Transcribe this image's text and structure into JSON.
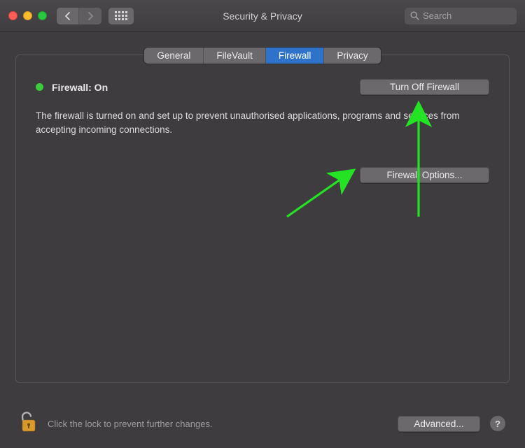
{
  "window": {
    "title": "Security & Privacy",
    "search_placeholder": "Search"
  },
  "tabs": [
    {
      "label": "General"
    },
    {
      "label": "FileVault"
    },
    {
      "label": "Firewall",
      "active": true
    },
    {
      "label": "Privacy"
    }
  ],
  "firewall": {
    "status_label": "Firewall: On",
    "status_color": "#3ccb3c",
    "turn_off_label": "Turn Off Firewall",
    "description": "The firewall is turned on and set up to prevent unauthorised applications, programs and services from accepting incoming connections.",
    "options_label": "Firewall Options..."
  },
  "footer": {
    "lock_text": "Click the lock to prevent further changes.",
    "advanced_label": "Advanced...",
    "help_label": "?"
  },
  "annotations": {
    "arrow_color": "#24e224"
  }
}
